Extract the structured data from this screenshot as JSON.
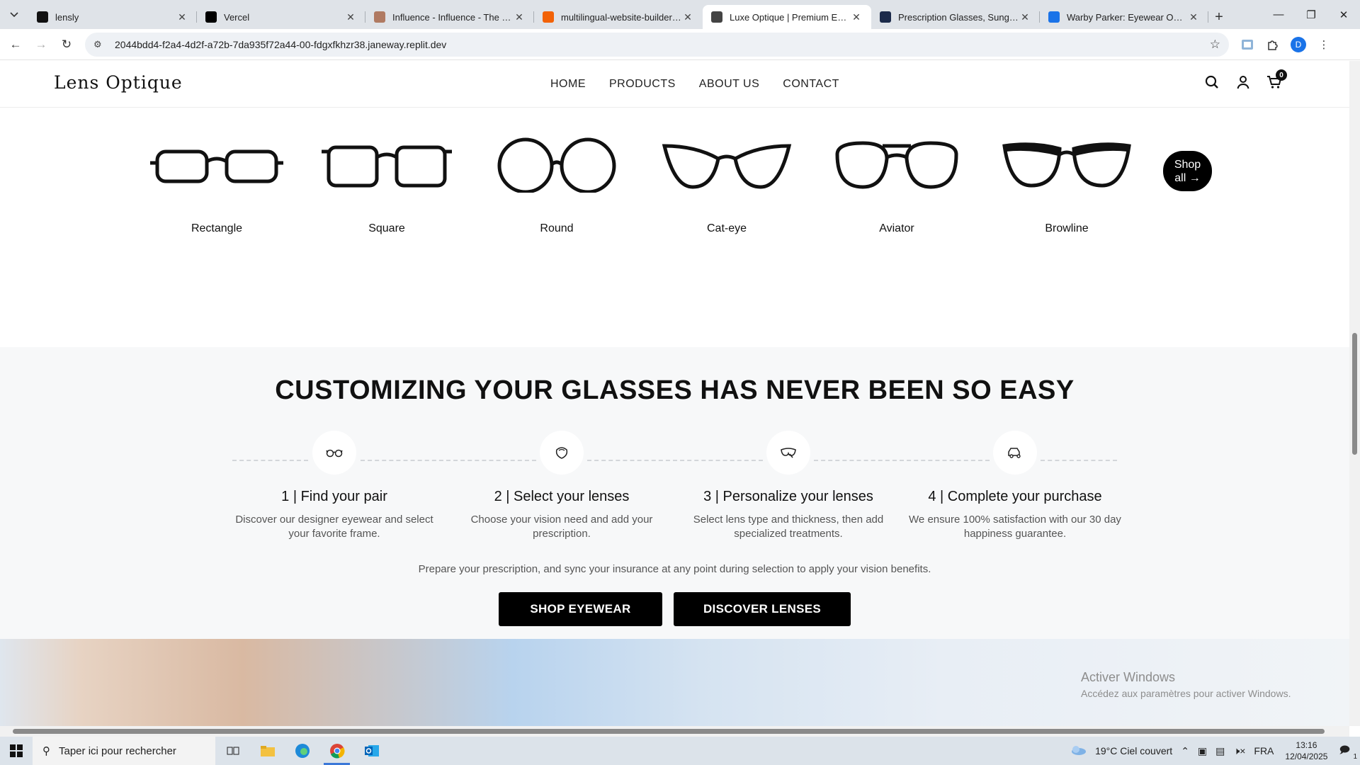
{
  "browser": {
    "tabs": [
      {
        "title": "lensly",
        "icon": "shield-favicon",
        "color": "#111111"
      },
      {
        "title": "Vercel",
        "icon": "vercel-favicon",
        "color": "#000000"
      },
      {
        "title": "Influence - Influence - The Psyc",
        "icon": "book-favicon",
        "color": "#b07a62"
      },
      {
        "title": "multilingual-website-builder - R",
        "icon": "replit-favicon",
        "color": "#f26207"
      },
      {
        "title": "Luxe Optique | Premium Eyewe",
        "icon": "globe-favicon",
        "color": "#444444"
      },
      {
        "title": "Prescription Glasses, Sunglasse",
        "icon": "lc-favicon",
        "color": "#1b2a4a"
      },
      {
        "title": "Warby Parker: Eyewear Online |",
        "icon": "wp-favicon",
        "color": "#1a73e8"
      }
    ],
    "url": "2044bdd4-f2a4-4d2f-a72b-7da935f72a44-00-fdgxfkhzr38.janeway.replit.dev",
    "profile_initial": "D"
  },
  "site": {
    "logo": "Lens Optique",
    "nav": [
      "HOME",
      "PRODUCTS",
      "ABOUT US",
      "CONTACT"
    ],
    "cart_count": "0"
  },
  "shapes": {
    "items": [
      "Rectangle",
      "Square",
      "Round",
      "Cat-eye",
      "Aviator",
      "Browline"
    ],
    "shop_all_line1": "Shop",
    "shop_all_line2": "all →"
  },
  "customize": {
    "heading": "CUSTOMIZING YOUR GLASSES HAS NEVER BEEN SO EASY",
    "steps": [
      {
        "title": "1 | Find your pair",
        "desc": "Discover our designer eyewear and select your favorite frame.",
        "icon": "glasses-icon"
      },
      {
        "title": "2 | Select your lenses",
        "desc": "Choose your vision need and add your prescription.",
        "icon": "lens-icon"
      },
      {
        "title": "3 | Personalize your lenses",
        "desc": "Select lens type and thickness, then add specialized treatments.",
        "icon": "lens-tint-icon"
      },
      {
        "title": "4 | Complete your purchase",
        "desc": "We ensure 100% satisfaction with our 30 day happiness guarantee.",
        "icon": "delivery-icon"
      }
    ],
    "note": "Prepare your prescription, and sync your insurance at any point during selection to apply your vision benefits.",
    "btn_shop": "SHOP EYEWEAR",
    "btn_discover": "DISCOVER LENSES"
  },
  "watermark": {
    "line1": "Activer Windows",
    "line2": "Accédez aux paramètres pour activer Windows."
  },
  "taskbar": {
    "search_placeholder": "Taper ici pour rechercher",
    "weather": "19°C  Ciel couvert",
    "lang": "FRA",
    "time": "13:16",
    "date": "12/04/2025",
    "notification_count": "1"
  }
}
